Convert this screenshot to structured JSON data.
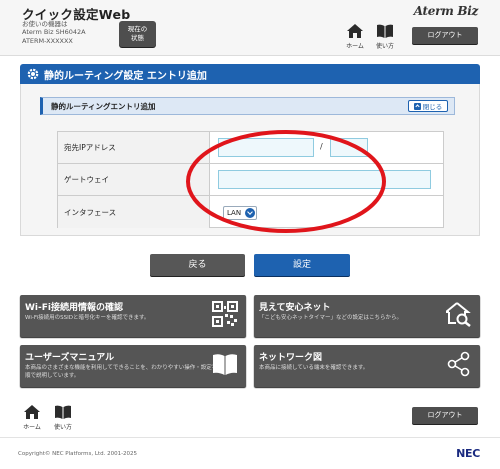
{
  "header": {
    "app_title": "クイック設定Web",
    "device_label": "お使いの機器は",
    "device_model": "Aterm Biz SH6042A",
    "device_ssid": "ATERM-XXXXXX",
    "status_button_line1": "現在の",
    "status_button_line2": "状態",
    "brand": "Aterm Biz",
    "home_label": "ホーム",
    "help_label": "使い方",
    "logout_label": "ログアウト"
  },
  "page": {
    "title": "静的ルーティング設定 エントリ追加",
    "section_title": "静的ルーティングエントリ追加",
    "collapse_label": "閉じる"
  },
  "form": {
    "dest_ip_label": "宛先IPアドレス",
    "dest_ip_value": "",
    "dest_ip_separator": "/",
    "dest_mask_value": "",
    "gateway_label": "ゲートウェイ",
    "gateway_value": "",
    "interface_label": "インタフェース",
    "interface_selected": "LAN"
  },
  "actions": {
    "back_label": "戻る",
    "set_label": "設定"
  },
  "tiles": [
    {
      "title": "Wi-Fi接続用情報の確認",
      "desc": "Wi-Fi接続用のSSIDと暗号化キーを確認できます。"
    },
    {
      "title": "見えて安心ネット",
      "desc": "「こども安心ネットタイマー」などの設定はこちらから。"
    },
    {
      "title": "ユーザーズマニュアル",
      "desc": "本商品のさまざまな機能を利用してできることを、わかりやすい操作・設定手順で説明しています。"
    },
    {
      "title": "ネットワーク図",
      "desc": "本商品に接続している端末を確認できます。"
    }
  ],
  "footer": {
    "home_label": "ホーム",
    "help_label": "使い方",
    "logout_label": "ログアウト",
    "copyright": "Copyright© NEC Platforms, Ltd. 2001-2025",
    "nec": "NEC"
  },
  "colors": {
    "accent_blue": "#1e62b0",
    "dark_button": "#4e4e4e",
    "annotation_red": "#e0151b"
  }
}
